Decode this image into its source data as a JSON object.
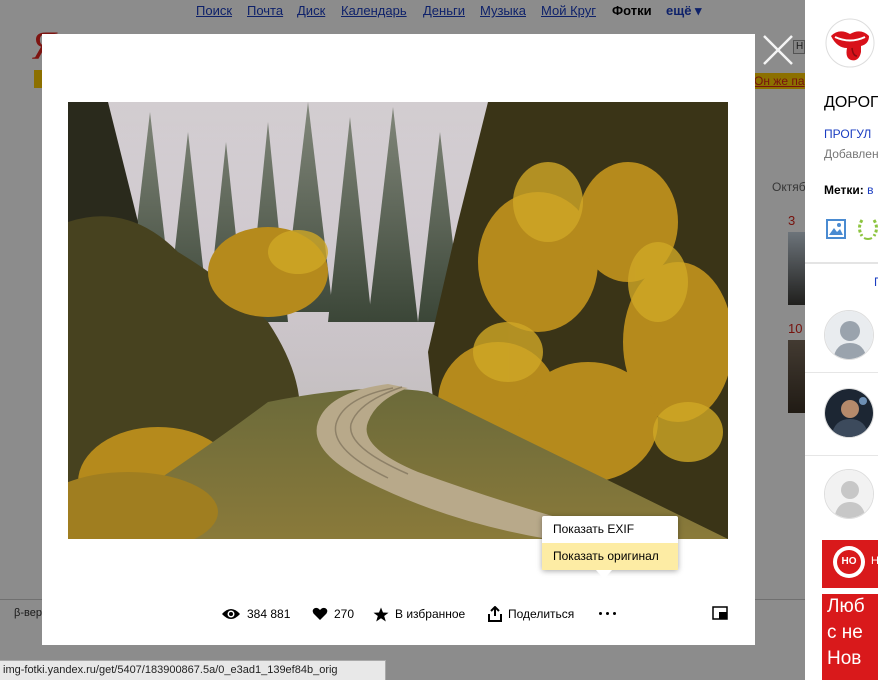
{
  "top_nav": {
    "items": [
      "Поиск",
      "Почта",
      "Диск",
      "Календарь",
      "Деньги",
      "Музыка",
      "Мой Круг",
      "Фотки"
    ],
    "active": "Фотки",
    "more_label": "ещё ▾"
  },
  "background": {
    "logo_letter": "Я",
    "promo_link": "Он же па",
    "beta_text": "β-вер",
    "month_label": "Октяб",
    "count_1": "3",
    "count_2": "10",
    "search_button": "Н"
  },
  "sidebar": {
    "title": "ДОРОГ",
    "album_link": "ПРОГУЛ",
    "added_text": "Добавлен",
    "tags_label": "Метки:",
    "tags_value": "в",
    "comments_link": "П"
  },
  "ad": {
    "tag": "Н",
    "line1": "Люб",
    "line2": "с не",
    "line3": "Нов",
    "logo_text": "НО"
  },
  "photo_actions": {
    "views": "384 881",
    "likes": "270",
    "favorite_label": "В избранное",
    "share_label": "Поделиться"
  },
  "more_menu": {
    "items": [
      "Показать EXIF",
      "Показать оригинал"
    ],
    "highlighted_index": 1
  },
  "status_bar": {
    "url": "img-fotki.yandex.ru/get/5407/183900867.5a/0_e3ad1_139ef84b_orig"
  },
  "colors": {
    "link_blue": "#1a3dc1",
    "yandex_red": "#e52620",
    "highlight_yellow": "#fdeca4",
    "ad_red": "#d9191b"
  }
}
